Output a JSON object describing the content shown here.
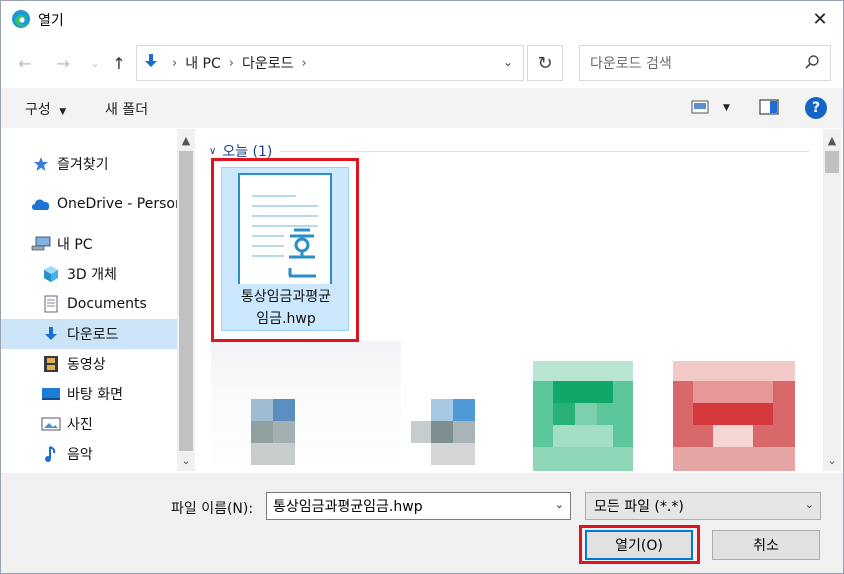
{
  "window": {
    "title": "열기"
  },
  "nav": {
    "back_icon": "back-arrow-icon",
    "forward_icon": "forward-arrow-icon",
    "recent_icon": "chevron-down-icon",
    "up_icon": "up-arrow-icon",
    "breadcrumb": [
      "내 PC",
      "다운로드"
    ],
    "search_placeholder": "다운로드 검색"
  },
  "toolbar": {
    "organize_label": "구성",
    "new_folder_label": "새 폴더"
  },
  "sidebar": {
    "items": [
      {
        "label": "즐겨찾기",
        "icon": "star-icon"
      },
      {
        "label": "OneDrive - Person",
        "icon": "cloud-icon"
      },
      {
        "label": "내 PC",
        "icon": "computer-icon"
      },
      {
        "label": "3D 개체",
        "icon": "cube-icon"
      },
      {
        "label": "Documents",
        "icon": "document-icon"
      },
      {
        "label": "다운로드",
        "icon": "download-icon",
        "selected": true
      },
      {
        "label": "동영상",
        "icon": "film-icon"
      },
      {
        "label": "바탕 화면",
        "icon": "desktop-icon"
      },
      {
        "label": "사진",
        "icon": "picture-icon"
      },
      {
        "label": "음악",
        "icon": "music-icon"
      }
    ]
  },
  "content": {
    "group_label": "오늘 (1)",
    "files": [
      {
        "name_line1": "통상임금과평균",
        "name_line2": "임금.hwp",
        "icon": "hwp-file-icon"
      }
    ]
  },
  "bottom": {
    "filename_label": "파일 이름(N):",
    "filename_value": "통상임금과평균임금.hwp",
    "filetype_value": "모든 파일 (*.*)",
    "open_label": "열기(O)",
    "cancel_label": "취소"
  },
  "colors": {
    "accent": "#0078d7",
    "selection": "#cce8ff",
    "highlight_box": "#e0141e",
    "help": "#1464c8"
  }
}
